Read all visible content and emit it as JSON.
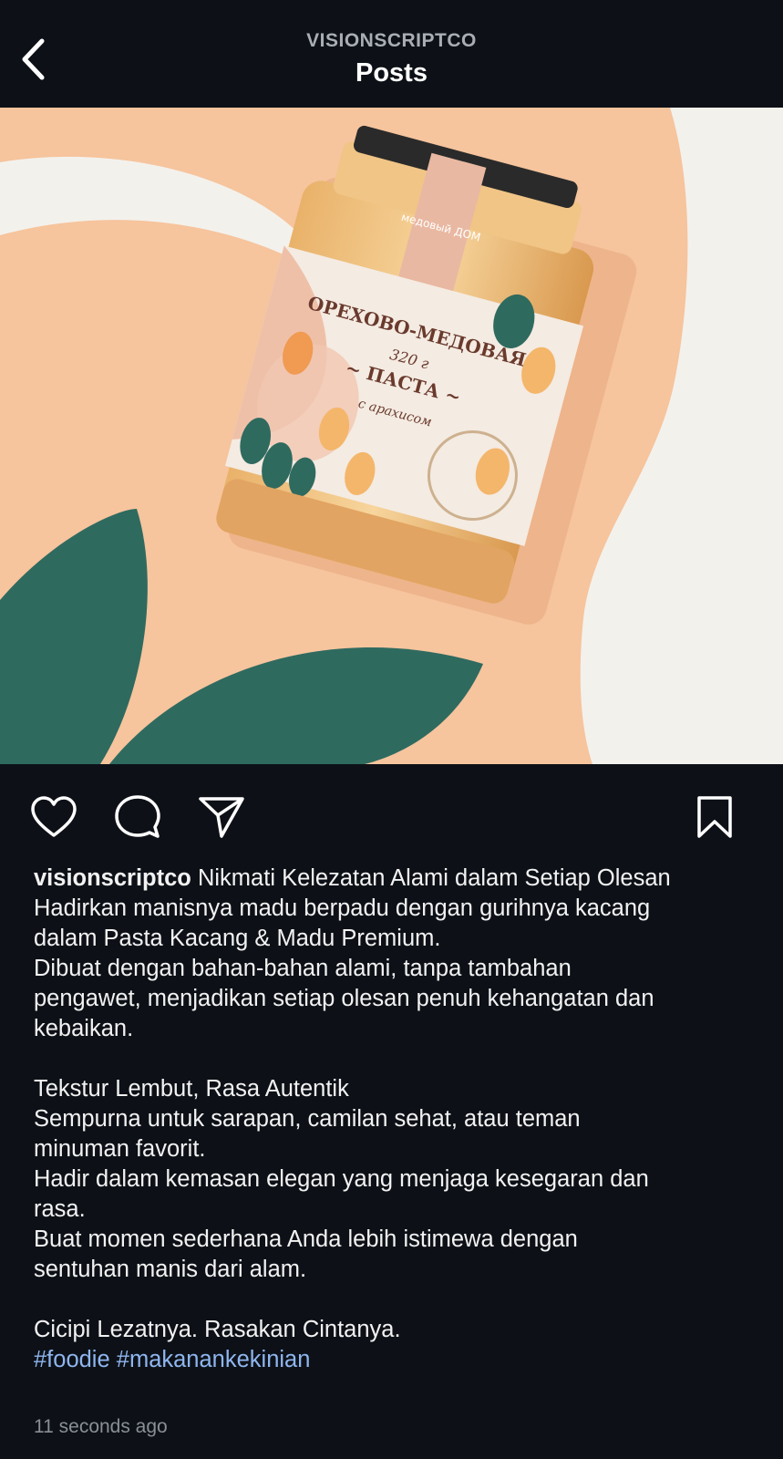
{
  "header": {
    "account": "VISIONSCRIPTCO",
    "title": "Posts"
  },
  "post": {
    "image_text": {
      "brand": "медовый ДОМ",
      "product": "ОРЕХОВО-МЕДОВАЯ",
      "weight": "320 г",
      "type": "~ ПАСТА ~",
      "flavor": "с арахисом"
    },
    "caption": {
      "username": "visionscriptco",
      "first_line": " Nikmati Kelezatan Alami dalam Setiap Olesan",
      "lines": [
        "Hadirkan manisnya madu berpadu dengan gurihnya kacang",
        "dalam Pasta Kacang & Madu Premium.",
        "Dibuat dengan bahan-bahan alami, tanpa tambahan",
        "pengawet, menjadikan setiap olesan penuh kehangatan dan",
        "kebaikan.",
        "",
        "Tekstur Lembut, Rasa Autentik",
        "Sempurna untuk sarapan, camilan sehat, atau teman",
        "minuman favorit.",
        "Hadir dalam kemasan elegan yang menjaga kesegaran dan",
        "rasa.",
        "Buat momen sederhana Anda lebih istimewa dengan",
        "sentuhan manis dari alam.",
        "",
        "Cicipi Lezatnya. Rasakan Cintanya."
      ],
      "hashtags": [
        "#foodie",
        "#makanankekinian"
      ]
    },
    "timestamp": "11 seconds ago"
  },
  "icons": {
    "back": "chevron-left-icon",
    "like": "heart-icon",
    "comment": "comment-bubble-icon",
    "share": "paper-plane-icon",
    "save": "bookmark-icon"
  },
  "colors": {
    "background": "#0d1117",
    "peach": "#f6c6a0",
    "leaf_green": "#2f6a5f",
    "hashtag": "#8fb6f0"
  }
}
